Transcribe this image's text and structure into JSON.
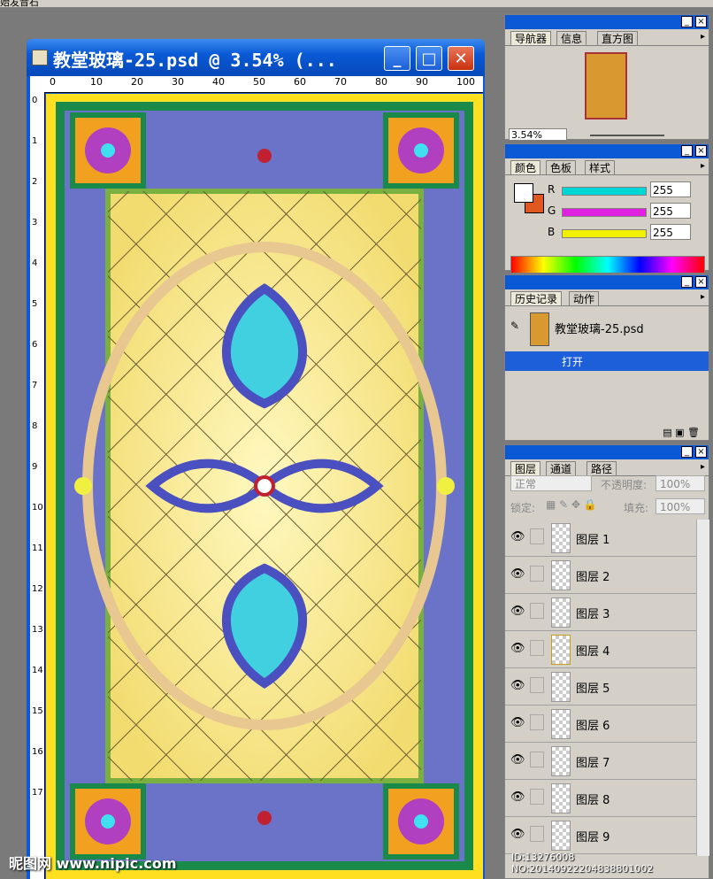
{
  "app": {
    "menu_fragment": "始发音石"
  },
  "document": {
    "title": "教堂玻璃-25.psd @ 3.54% (...",
    "ruler_top_labels": [
      "0",
      "10",
      "20",
      "30",
      "40",
      "50",
      "60",
      "70",
      "80",
      "90",
      "100"
    ],
    "ruler_left_labels": [
      "0",
      "1",
      "2",
      "3",
      "4",
      "5",
      "6",
      "7",
      "8",
      "9",
      "10",
      "11",
      "12",
      "13",
      "14",
      "15",
      "16",
      "17"
    ],
    "buttons": {
      "minimize": "_",
      "maximize": "□",
      "close": "✕"
    }
  },
  "navigator": {
    "tabs": [
      "导航器",
      "信息",
      "直方图"
    ],
    "zoom": "3.54%"
  },
  "color": {
    "tabs": [
      "颜色",
      "色板",
      "样式"
    ],
    "channels": [
      {
        "label": "R",
        "value": "255",
        "color": "#00d8d8"
      },
      {
        "label": "G",
        "value": "255",
        "color": "#e020e0"
      },
      {
        "label": "B",
        "value": "255",
        "color": "#f0f000"
      }
    ]
  },
  "history": {
    "tabs": [
      "历史记录",
      "动作"
    ],
    "snapshot": "教堂玻璃-25.psd",
    "step": "打开"
  },
  "layers": {
    "tabs": [
      "图层",
      "通道",
      "路径"
    ],
    "blend_mode": "正常",
    "opacity_label": "不透明度:",
    "opacity": "100%",
    "lock_label": "锁定:",
    "fill_label": "填充:",
    "fill": "100%",
    "items": [
      "图层 1",
      "图层 2",
      "图层 3",
      "图层 4",
      "图层 5",
      "图层 6",
      "图层 7",
      "图层 8",
      "图层 9"
    ]
  },
  "watermark": {
    "site": "昵图网 www.nipic.com",
    "id": "ID:13276008 NO:20140922204838801002"
  }
}
